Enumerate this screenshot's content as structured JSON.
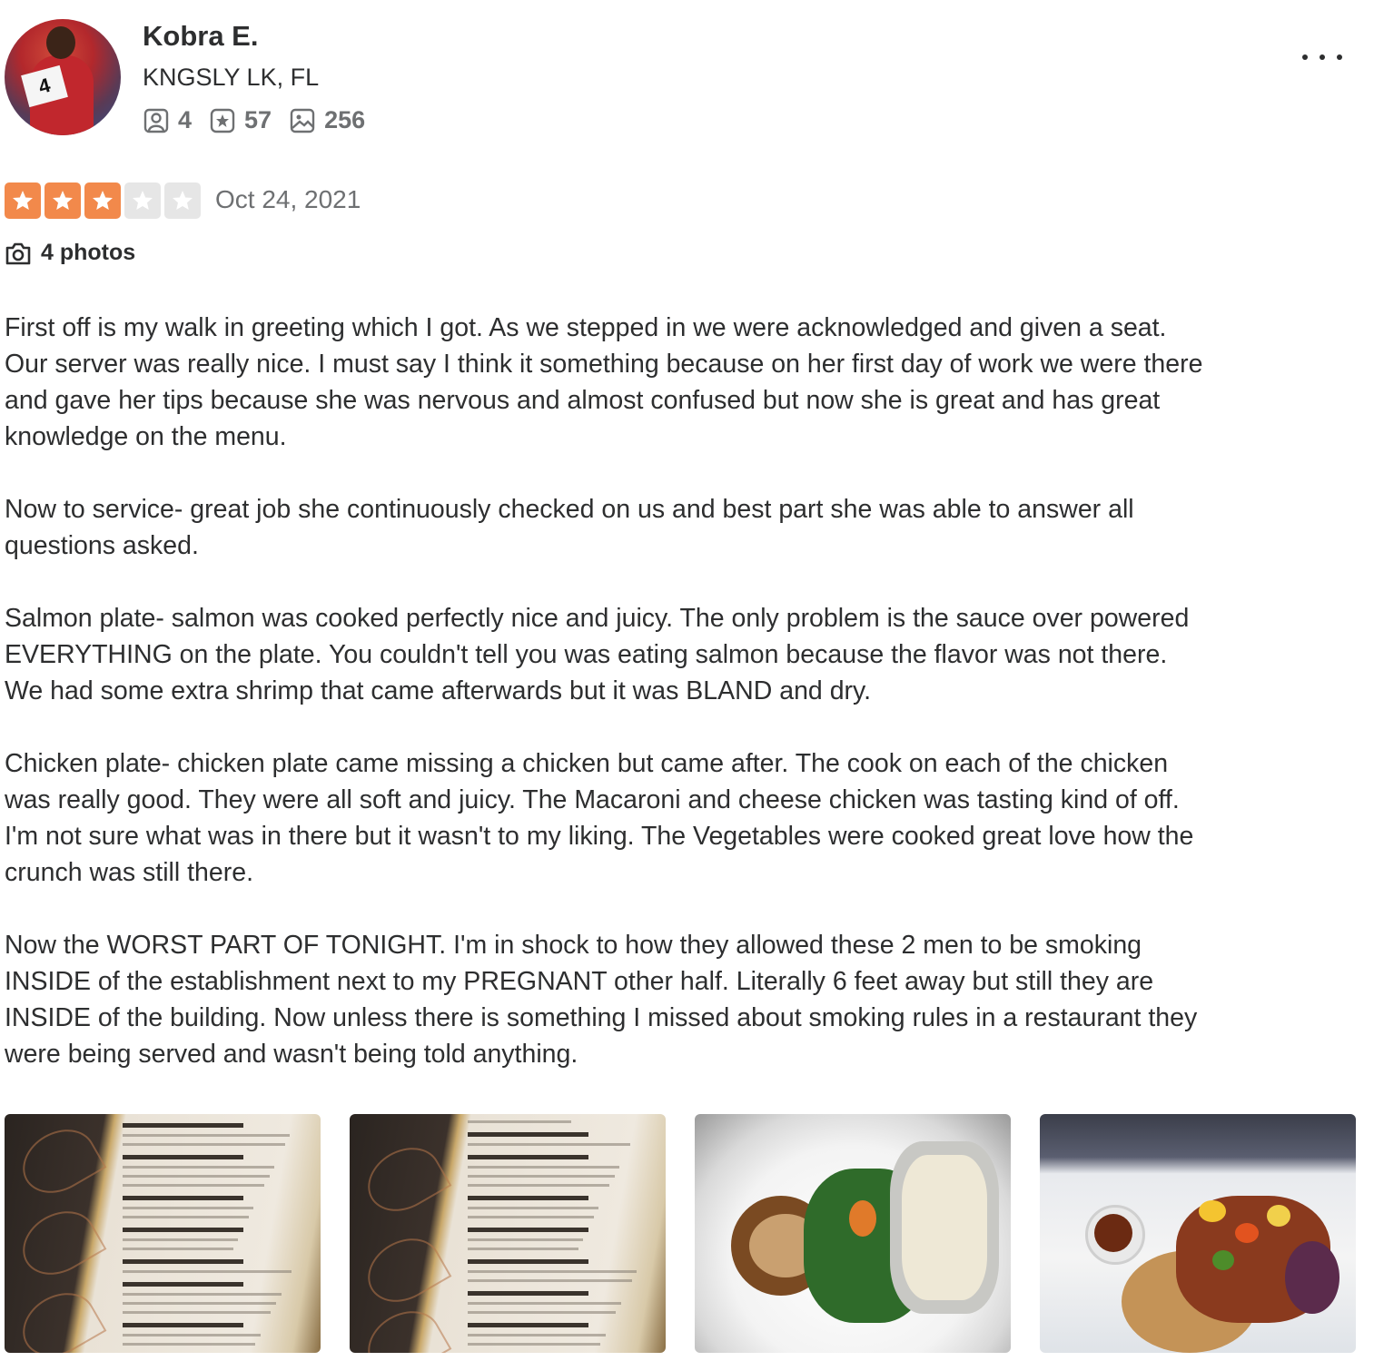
{
  "user": {
    "name": "Kobra E.",
    "location": "KNGSLY LK, FL",
    "friends": "4",
    "reviews": "57",
    "photos": "256",
    "avatar_card_text": "4"
  },
  "review": {
    "rating": 3,
    "rating_max": 5,
    "date": "Oct 24, 2021",
    "photos_link": "4 photos",
    "paragraphs": [
      "First off is my walk in greeting which I got. As we stepped in we were acknowledged and given a seat. Our server was really nice. I must say I think it something because on her first day of work we were there and gave her tips because she was nervous and almost confused but now she is great and has great knowledge on the menu.",
      "Now to service- great job she continuously checked on us and best part she was able to answer all questions asked.",
      "Salmon plate- salmon was cooked perfectly nice and juicy. The only problem is the sauce over powered EVERYTHING on the plate. You couldn't tell you was eating salmon because the flavor was not there. We had some extra shrimp that came afterwards but it was BLAND and dry.",
      "Chicken plate- chicken plate came missing a chicken but came after. The cook on each of the chicken was really good. They were all soft and juicy. The Macaroni and cheese chicken was tasting kind of off. I'm not sure what was in there but it wasn't to my liking. The Vegetables were cooked great love how the crunch was still there.",
      "Now the WORST PART OF TONIGHT. I'm in shock to how they allowed these 2 men to be smoking INSIDE of the establishment next to my PREGNANT other half. Literally 6 feet away but still they are INSIDE of the building. Now unless there is something I missed about smoking rules in a restaurant they were being served and wasn't being told anything."
    ]
  },
  "icons": {
    "friends": "friends-icon",
    "reviews": "review-star-icon",
    "photos": "photo-icon",
    "camera": "camera-icon",
    "more": "more-options-icon"
  },
  "colors": {
    "star_on": "#f2894b",
    "star_off": "#e6e6e6",
    "text": "#2d2e2f",
    "muted": "#6e7072"
  },
  "gallery": [
    {
      "name": "menu-photo-1"
    },
    {
      "name": "menu-photo-2"
    },
    {
      "name": "chicken-plate-photo"
    },
    {
      "name": "salmon-plate-photo"
    }
  ]
}
